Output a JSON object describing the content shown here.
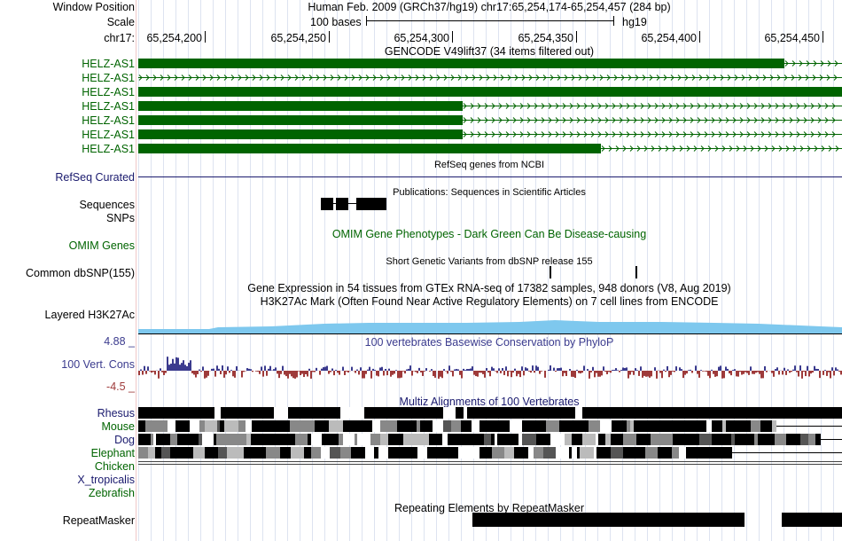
{
  "header": {
    "window_position_label": "Window Position",
    "scale_label": "Scale",
    "chrom_label": "chr17:",
    "position_text": "Human Feb. 2009 (GRCh37/hg19)   chr17:65,254,174-65,254,457 (284 bp)",
    "scale_text": "100 bases",
    "assembly": "hg19",
    "ruler_ticks": [
      "65,254,200",
      "65,254,250",
      "65,254,300",
      "65,254,350",
      "65,254,400",
      "65,254,450"
    ]
  },
  "tracks": {
    "gencode": {
      "title": "GENCODE V49lift37 (34 items filtered out)",
      "items": [
        "HELZ-AS1",
        "HELZ-AS1",
        "HELZ-AS1",
        "HELZ-AS1",
        "HELZ-AS1",
        "HELZ-AS1",
        "HELZ-AS1"
      ]
    },
    "refseq": {
      "title": "RefSeq genes from NCBI",
      "label": "RefSeq Curated"
    },
    "publications": {
      "title": "Publications: Sequences in Scientific Articles",
      "label": "Sequences"
    },
    "snps": {
      "label": "SNPs"
    },
    "omim": {
      "title": "OMIM Gene Phenotypes - Dark Green Can Be Disease-causing",
      "label": "OMIM Genes"
    },
    "dbsnp": {
      "title": "Short Genetic Variants from dbSNP release 155",
      "label": "Common dbSNP(155)"
    },
    "gtex": {
      "title": "Gene Expression in 54 tissues from GTEx RNA-seq of 17382 samples, 948 donors (V8, Aug 2019)"
    },
    "h3k27ac": {
      "title": "H3K27Ac Mark (Often Found Near Active Regulatory Elements) on 7 cell lines from ENCODE",
      "label": "Layered H3K27Ac"
    },
    "phylop": {
      "title": "100 vertebrates Basewise Conservation by PhyloP",
      "label": "100 Vert. Cons",
      "max": "4.88 _",
      "min": "-4.5 _"
    },
    "multiz": {
      "title": "Multiz Alignments of 100 Vertebrates",
      "species": [
        "Rhesus",
        "Mouse",
        "Dog",
        "Elephant",
        "Chicken",
        "X_tropicalis",
        "Zebrafish"
      ]
    },
    "repeatmasker": {
      "title": "Repeating Elements by RepeatMasker",
      "label": "RepeatMasker"
    }
  },
  "colors": {
    "gencode": "#006400",
    "label_green": "#006400",
    "label_navy": "#1a1a6e",
    "phylop_pos": "#3b3b8e",
    "phylop_neg": "#9e3a3a",
    "h3k27ac": "#7ec8ee"
  }
}
